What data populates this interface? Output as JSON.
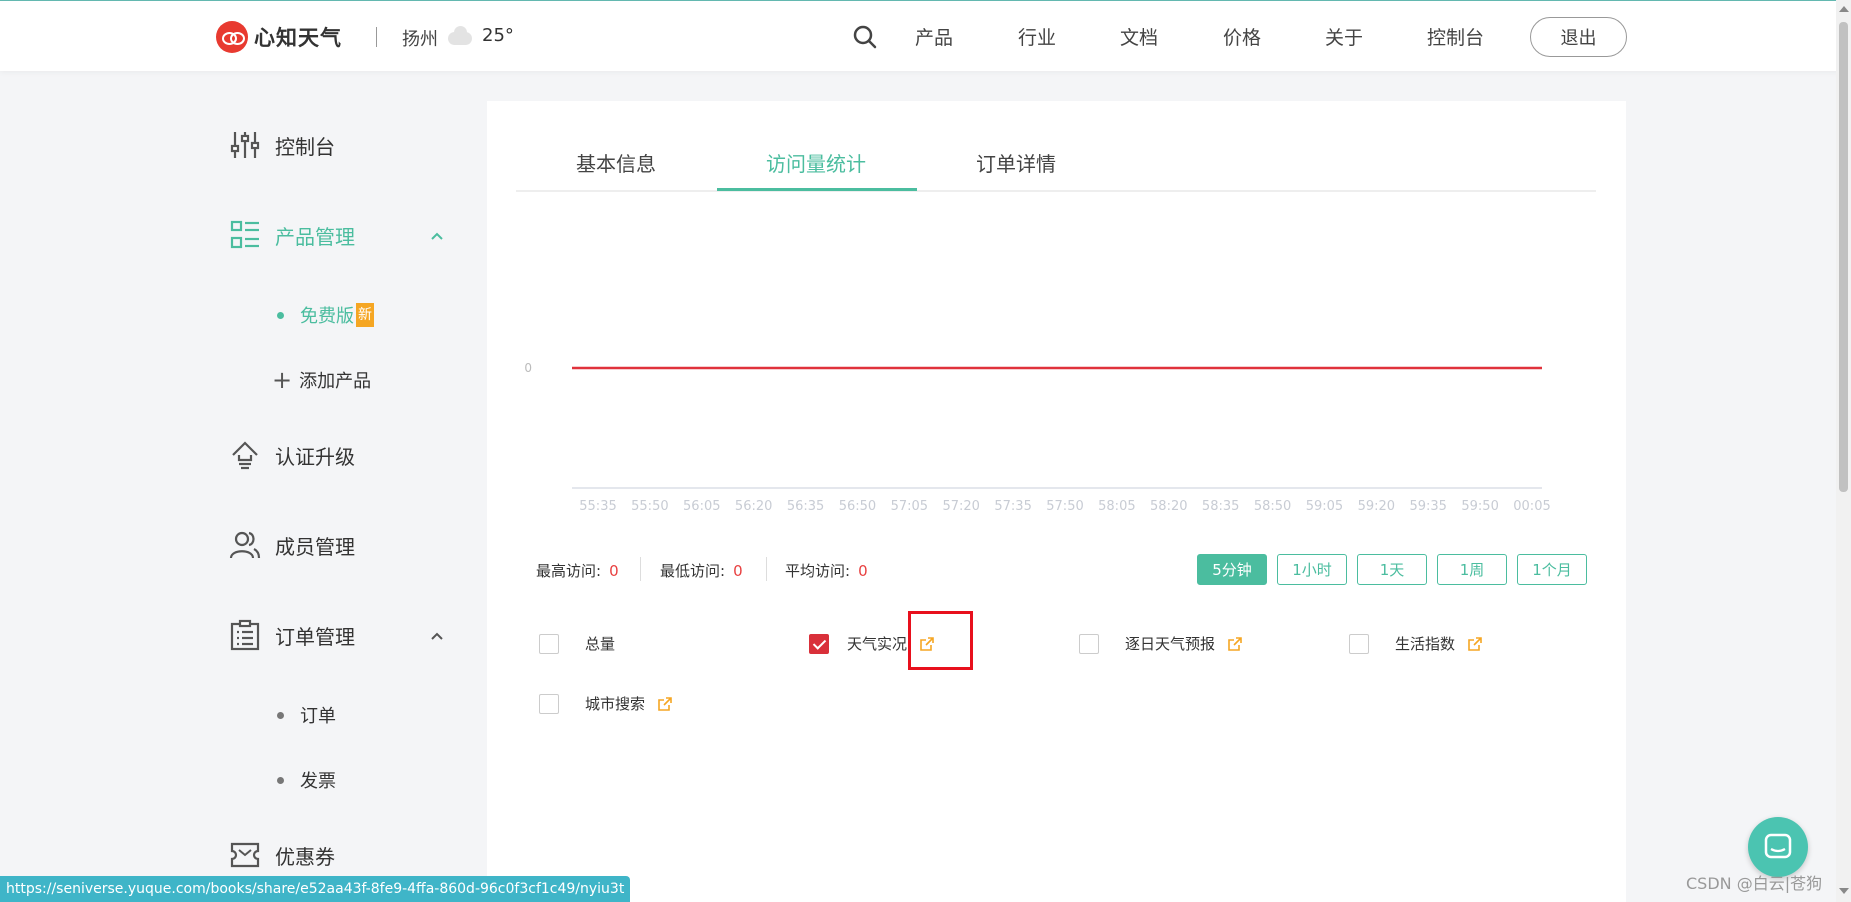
{
  "header": {
    "brand": "心知天气",
    "city": "扬州",
    "temperature": "25°",
    "nav": [
      "产品",
      "行业",
      "文档",
      "价格",
      "关于",
      "控制台"
    ],
    "logout_label": "退出"
  },
  "sidebar": {
    "dashboard": "控制台",
    "product_mgmt": "产品管理",
    "free_plan": "免费版",
    "new_badge": "新",
    "add_product": "添加产品",
    "upgrade": "认证升级",
    "members": "成员管理",
    "order_mgmt": "订单管理",
    "orders": "订单",
    "invoice": "发票",
    "coupons": "优惠券"
  },
  "tabs": [
    "基本信息",
    "访问量统计",
    "订单详情"
  ],
  "active_tab": "访问量统计",
  "chart_data": {
    "type": "line",
    "x": [
      "55:35",
      "55:50",
      "56:05",
      "56:20",
      "56:35",
      "56:50",
      "57:05",
      "57:20",
      "57:35",
      "57:50",
      "58:05",
      "58:20",
      "58:35",
      "58:50",
      "59:05",
      "59:20",
      "59:35",
      "59:50",
      "00:05"
    ],
    "series": [
      {
        "values": [
          0,
          0,
          0,
          0,
          0,
          0,
          0,
          0,
          0,
          0,
          0,
          0,
          0,
          0,
          0,
          0,
          0,
          0,
          0
        ],
        "color": "#e0323c"
      }
    ],
    "y_tick_labels": [
      "0"
    ],
    "grid": false
  },
  "stats": {
    "max_label": "最高访问:",
    "max_value": "0",
    "min_label": "最低访问:",
    "min_value": "0",
    "avg_label": "平均访问:",
    "avg_value": "0"
  },
  "ranges": [
    "5分钟",
    "1小时",
    "1天",
    "1周",
    "1个月"
  ],
  "active_range": "5分钟",
  "apis": [
    {
      "label": "总量",
      "checked": false,
      "has_link": false
    },
    {
      "label": "天气实况",
      "checked": true,
      "has_link": true
    },
    {
      "label": "逐日天气预报",
      "checked": false,
      "has_link": true
    },
    {
      "label": "生活指数",
      "checked": false,
      "has_link": true
    },
    {
      "label": "城市搜索",
      "checked": false,
      "has_link": true
    }
  ],
  "status_url": "https://seniverse.yuque.com/books/share/e52aa43f-8fe9-4ffa-860d-96c0f3cf1c49/nyiu3t",
  "watermark": "CSDN @白云|苍狗",
  "colors": {
    "accent": "#4bbd9f",
    "brand_red": "#e83a30",
    "line": "#e0323c",
    "badge": "#f5a623"
  }
}
